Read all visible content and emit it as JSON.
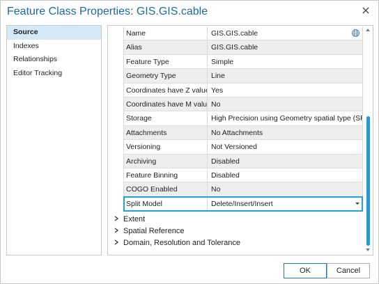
{
  "window": {
    "title": "Feature Class Properties: GIS.GIS.cable"
  },
  "nav": {
    "items": [
      {
        "label": "Source",
        "active": true
      },
      {
        "label": "Indexes",
        "active": false
      },
      {
        "label": "Relationships",
        "active": false
      },
      {
        "label": "Editor Tracking",
        "active": false
      }
    ]
  },
  "properties": [
    {
      "name": "Name",
      "value": "GIS.GIS.cable"
    },
    {
      "name": "Alias",
      "value": "GIS.GIS.cable"
    },
    {
      "name": "Feature Type",
      "value": "Simple"
    },
    {
      "name": "Geometry Type",
      "value": "Line"
    },
    {
      "name": "Coordinates have Z value",
      "value": "Yes"
    },
    {
      "name": "Coordinates have M value",
      "value": "No"
    },
    {
      "name": "Storage",
      "value": "High Precision using Geometry spatial type (SRID"
    },
    {
      "name": "Attachments",
      "value": "No Attachments"
    },
    {
      "name": "Versioning",
      "value": "Not Versioned"
    },
    {
      "name": "Archiving",
      "value": "Disabled"
    },
    {
      "name": "Feature Binning",
      "value": "Disabled"
    },
    {
      "name": "COGO Enabled",
      "value": "No"
    },
    {
      "name": "Split Model",
      "value": "Delete/Insert/Insert"
    }
  ],
  "sections": [
    {
      "label": "Extent"
    },
    {
      "label": "Spatial Reference"
    },
    {
      "label": "Domain, Resolution and Tolerance"
    }
  ],
  "buttons": {
    "ok": "OK",
    "cancel": "Cancel"
  },
  "colors": {
    "accent": "#1fa3d8",
    "title": "#1a6aa6",
    "nav_active": "#d5e8f6",
    "scroll_thumb": "#1f9bd9"
  },
  "icons": {
    "close": "close-icon",
    "name_field": "globe-settings-icon",
    "section_toggle": "chevron-right-icon",
    "dropdown": "chevron-down-icon"
  }
}
